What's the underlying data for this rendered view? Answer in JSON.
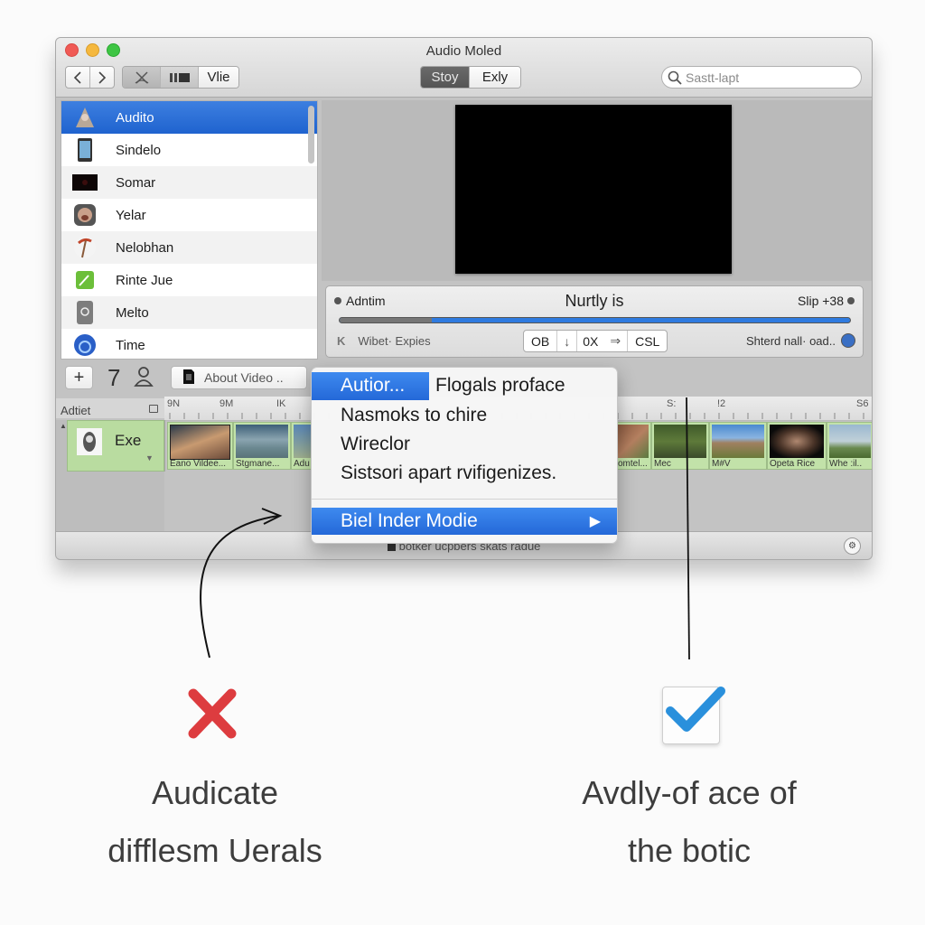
{
  "window": {
    "title": "Audio Moled",
    "nav": {
      "back_icon": "chevron-left-icon",
      "forward_icon": "chevron-right-icon"
    },
    "view_segment": {
      "items": [
        {
          "icon": "cut-icon"
        },
        {
          "icon": "filmstrip-icon"
        },
        {
          "label": "Vlie"
        }
      ]
    },
    "mode_segment": {
      "items": [
        {
          "label": "Stoy",
          "selected": true
        },
        {
          "label": "Exly",
          "selected": false
        }
      ]
    },
    "search": {
      "placeholder": "Sastt-lapt",
      "icon": "search-icon"
    }
  },
  "sidebar": {
    "items": [
      {
        "label": "Audito",
        "icon": "cone-icon",
        "selected": true
      },
      {
        "label": "Sindelo",
        "icon": "tablet-icon"
      },
      {
        "label": "Somar",
        "icon": "dark-thumbnail-icon"
      },
      {
        "label": "Yelar",
        "icon": "face-icon"
      },
      {
        "label": "Nelobhan",
        "icon": "pickaxe-icon"
      },
      {
        "label": "Rinte Jue",
        "icon": "green-pen-icon"
      },
      {
        "label": "Melto",
        "icon": "gray-app-icon"
      },
      {
        "label": "Time",
        "icon": "blue-circle-icon"
      }
    ],
    "footer": {
      "add_label": "+",
      "count": "7",
      "person_icon": "person-icon",
      "about_label": "About Video ..",
      "about_icon": "sd-card-icon"
    }
  },
  "controls": {
    "left_label": "Adntim",
    "center_label": "Nurtly is",
    "right_label": "Slip +38",
    "progress": 0.08,
    "playhead": 0.18,
    "bottom_left": "Wibet· Expies",
    "buttons": [
      "OB",
      "↓",
      "0X",
      "⇒",
      "CSL"
    ],
    "bottom_right": "Shterd nall· oad..",
    "accent": "#2f7be0"
  },
  "timeline": {
    "track_label": "Adtiet",
    "track_name": "Exe",
    "ruler_ticks": [
      "9N",
      "9M",
      "IK",
      "S:",
      "!2",
      "S6"
    ],
    "clips": [
      {
        "label": "Eano Vildee..."
      },
      {
        "label": "Stgmane..."
      },
      {
        "label": "Adu"
      },
      {
        "label": "omtel..."
      },
      {
        "label": "Mec"
      },
      {
        "label": "M#V"
      },
      {
        "label": "Opeta Rice"
      },
      {
        "label": "Whe :il.."
      }
    ]
  },
  "context_menu": {
    "items": [
      {
        "label": "Autior...",
        "highlighted": true
      },
      {
        "label": "Flogals proface"
      },
      {
        "label": "Nasmoks to chire"
      },
      {
        "label": "Wireclor"
      },
      {
        "label": "Sistsori apart rvifigenizes."
      },
      {
        "label": "Biel Inder Modie",
        "highlighted": true,
        "submenu": true
      }
    ]
  },
  "status_bar": {
    "text": "botker ucpbers skats radue"
  },
  "annotations": {
    "bad": {
      "icon": "red-x-icon",
      "line1": "Audicate",
      "line2": "difflesm Uerals",
      "color": "#dd3c3f"
    },
    "good": {
      "icon": "blue-checkmark-icon",
      "line1": "Avdly-of ace of",
      "line2": "the botic",
      "color": "#2a90dc"
    }
  }
}
